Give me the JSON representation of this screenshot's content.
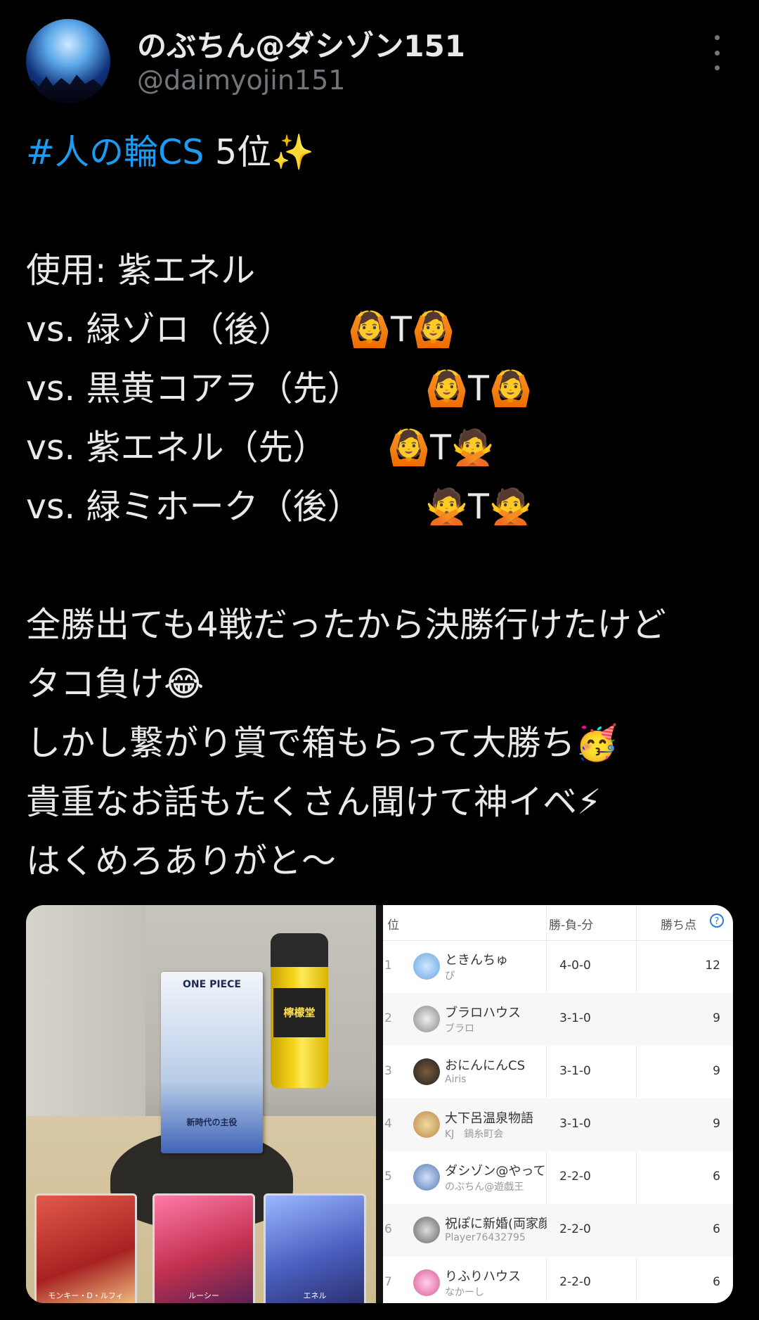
{
  "author": {
    "display_name": "のぶちん@ダシゾン151",
    "handle": "@daimyojin151"
  },
  "tweet": {
    "hashtag": "#人の輪CS",
    "headline_rest": " 5位✨",
    "used": "使用: 紫エネル",
    "matches": [
      {
        "opponent": "vs. 緑ゾロ（後）",
        "result": "🙆T🙆"
      },
      {
        "opponent": "vs. 黒黄コアラ（先）",
        "result": "🙆T🙆"
      },
      {
        "opponent": "vs. 紫エネル（先）",
        "result": "🙆T🙅"
      },
      {
        "opponent": "vs. 緑ミホーク（後）",
        "result": "🙅T🙅"
      }
    ],
    "lines": [
      "全勝出ても4戦だったから決勝行けたけど",
      "タコ負け😂",
      "しかし繋がり賞で箱もらって大勝ち🥳",
      "貴重なお話もたくさん聞けて神イベ⚡",
      "はくめろありがと〜"
    ]
  },
  "photo": {
    "booster_title": "ONE PIECE",
    "booster_label": "新時代の主役",
    "can_label": "檸檬堂",
    "cards": [
      "モンキー・D・ルフィ",
      "ルーシー",
      "エネル"
    ]
  },
  "standings": {
    "header": {
      "rank": "位",
      "wld": "勝-負-分",
      "points": "勝ち点",
      "help": "?"
    },
    "rows": [
      {
        "rank": "1",
        "name": "ときんちゅ",
        "sub": "ぴ",
        "wld": "4-0-0",
        "points": "12"
      },
      {
        "rank": "2",
        "name": "ブラロハウス",
        "sub": "ブラロ",
        "wld": "3-1-0",
        "points": "9"
      },
      {
        "rank": "3",
        "name": "おにんにんCS",
        "sub": "Airis",
        "wld": "3-1-0",
        "points": "9"
      },
      {
        "rank": "4",
        "name": "大下呂温泉物語",
        "sub": "KJ　鍋糸町会",
        "wld": "3-1-0",
        "points": "9"
      },
      {
        "rank": "5",
        "name": "ダシゾン@やって",
        "sub": "のぶちん@遊戯王",
        "wld": "2-2-0",
        "points": "6"
      },
      {
        "rank": "6",
        "name": "祝ぽに新婚(両家顔",
        "sub": "Player76432795",
        "wld": "2-2-0",
        "points": "6"
      },
      {
        "rank": "7",
        "name": "りふりハウス",
        "sub": "なかーし",
        "wld": "2-2-0",
        "points": "6"
      }
    ]
  },
  "colors": {
    "background": "#000000",
    "text": "#e7e9ea",
    "secondary": "#71767b",
    "link": "#1d9bf0"
  }
}
